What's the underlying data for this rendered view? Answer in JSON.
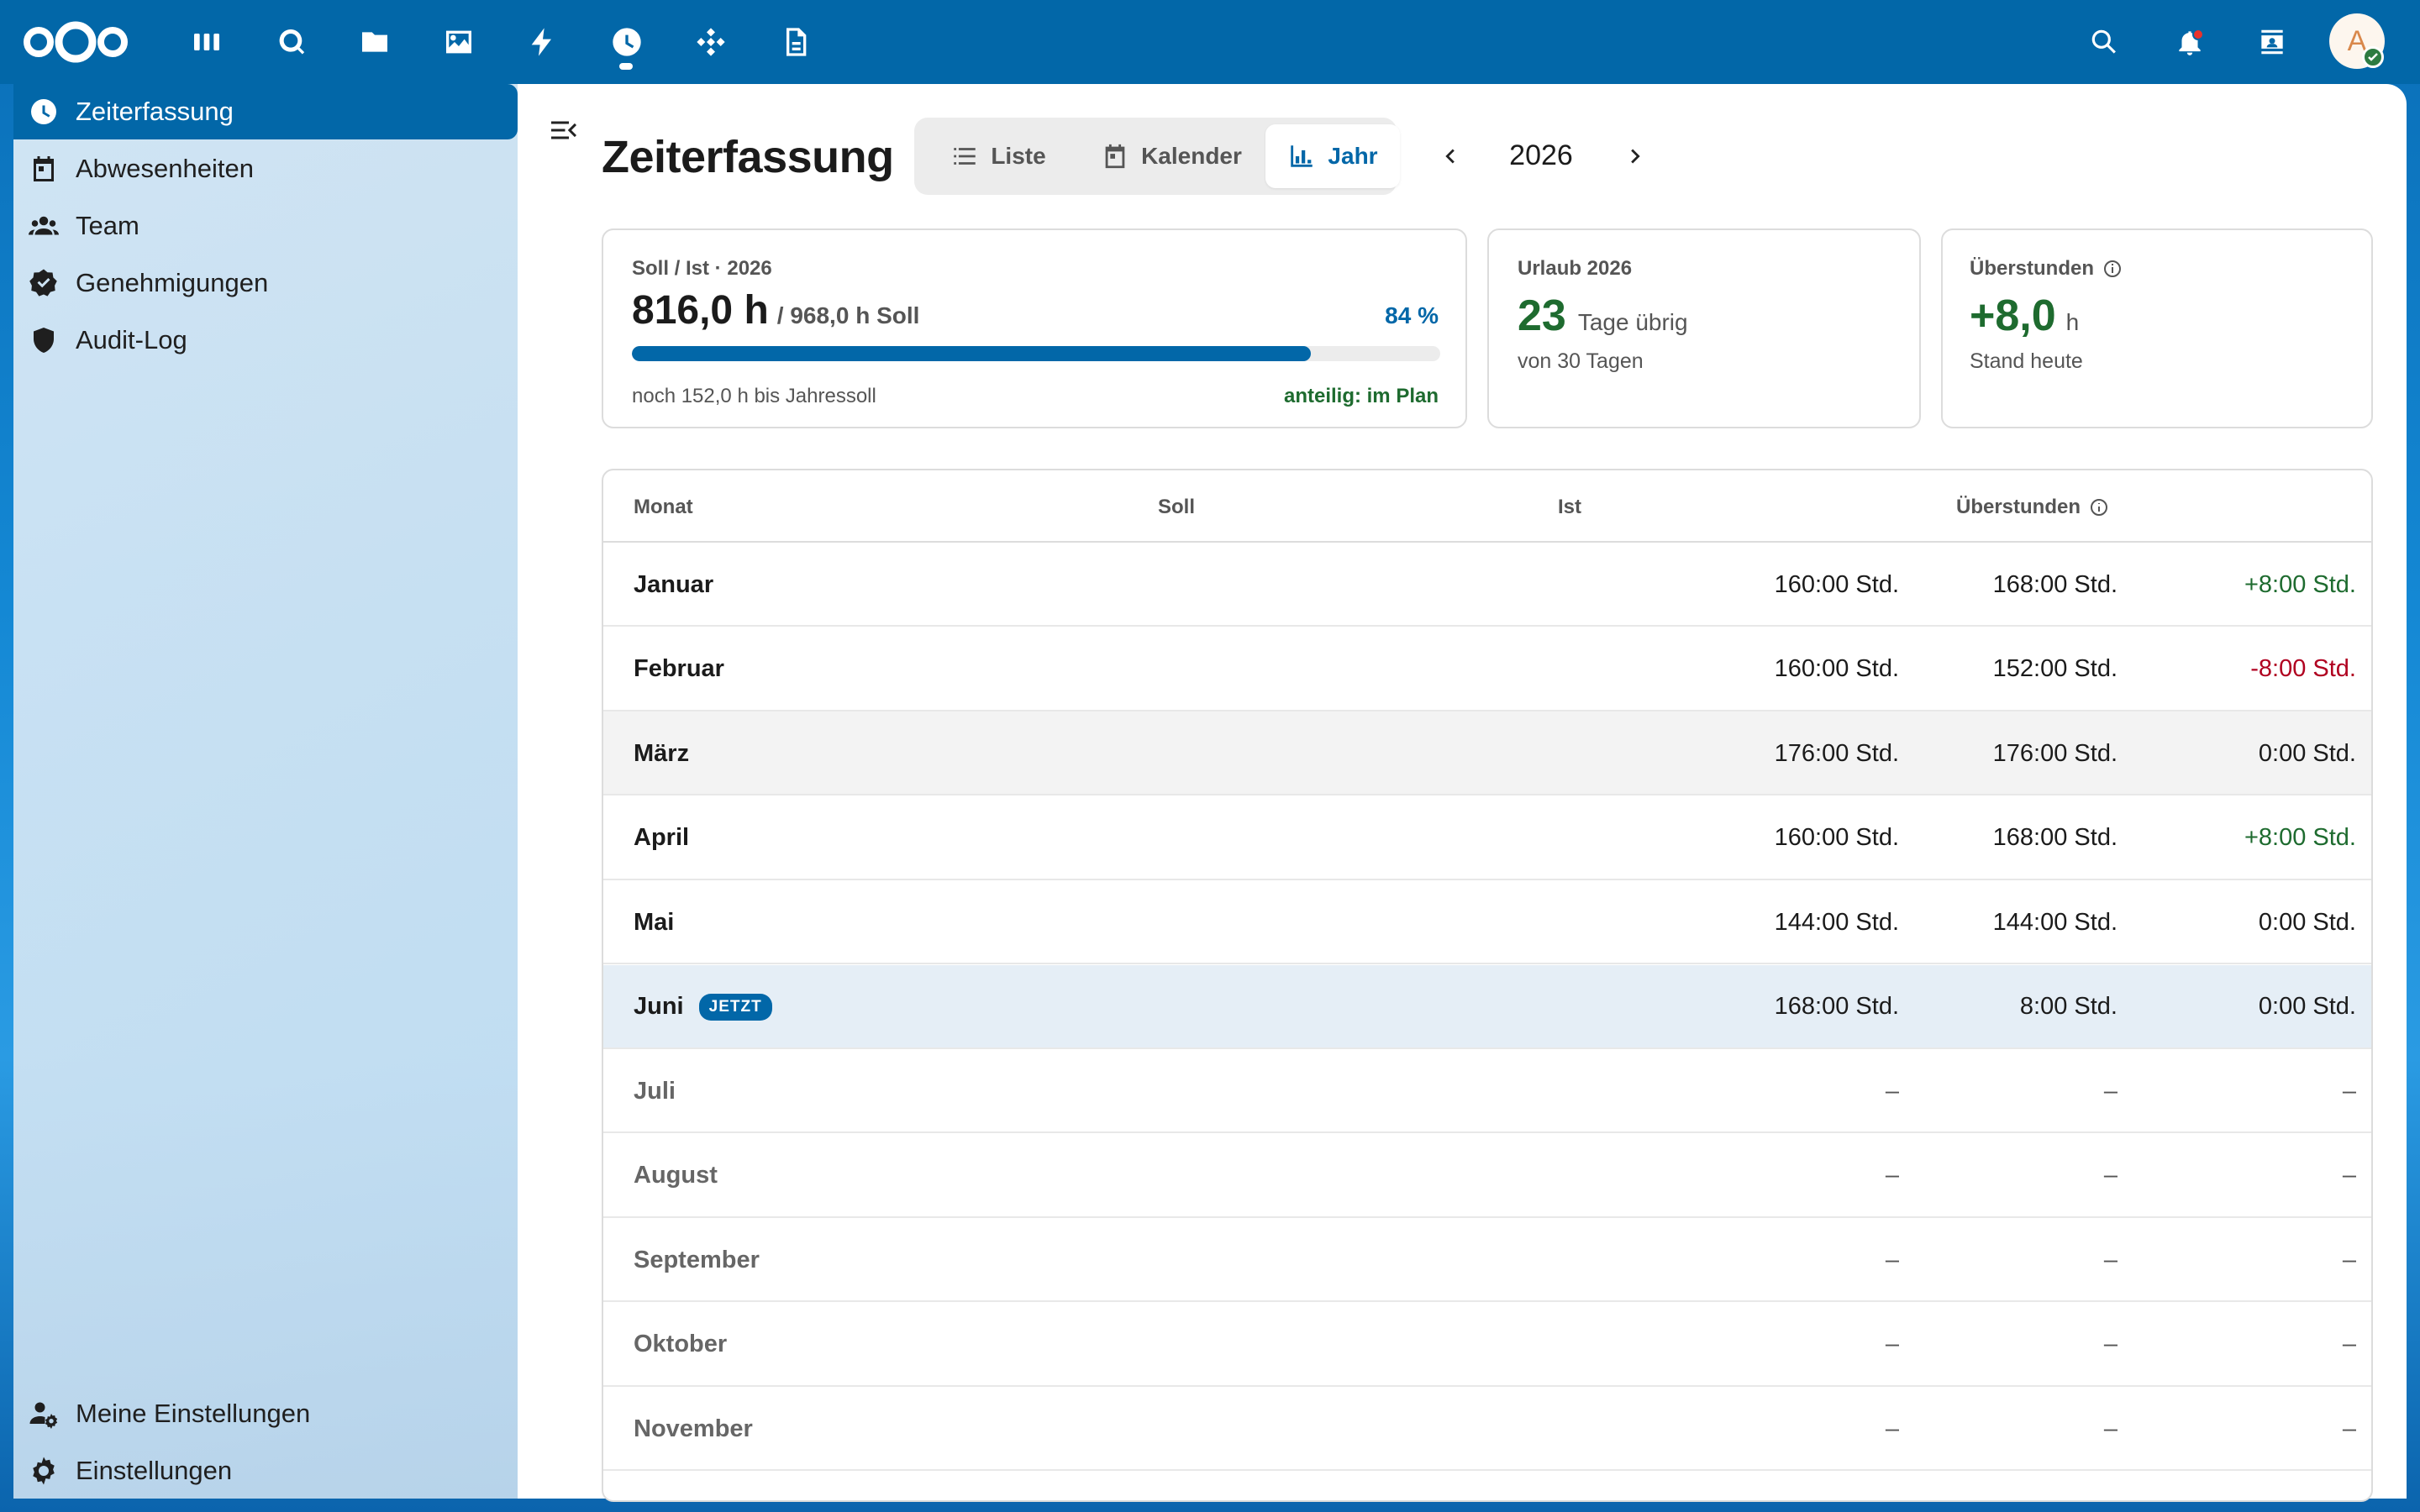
{
  "topbar": {
    "apps": [
      {
        "name": "dashboard-icon"
      },
      {
        "name": "search-app-icon"
      },
      {
        "name": "files-icon"
      },
      {
        "name": "photos-icon"
      },
      {
        "name": "activity-icon"
      },
      {
        "name": "timetracking-icon",
        "active": true
      },
      {
        "name": "integration-icon"
      },
      {
        "name": "text-icon"
      }
    ],
    "right": [
      "search-icon",
      "notifications-icon",
      "contacts-icon"
    ],
    "avatar_letter": "A"
  },
  "sidebar": {
    "items": [
      {
        "label": "Zeiterfassung",
        "icon": "clock-icon",
        "active": true
      },
      {
        "label": "Abwesenheiten",
        "icon": "calendar-icon"
      },
      {
        "label": "Team",
        "icon": "team-icon"
      },
      {
        "label": "Genehmigungen",
        "icon": "approval-icon"
      },
      {
        "label": "Audit-Log",
        "icon": "shield-icon"
      }
    ],
    "bottom": [
      {
        "label": "Meine Einstellungen",
        "icon": "user-settings-icon"
      },
      {
        "label": "Einstellungen",
        "icon": "gear-icon"
      }
    ]
  },
  "main": {
    "title": "Zeiterfassung",
    "views": [
      {
        "label": "Liste",
        "icon": "list-icon"
      },
      {
        "label": "Kalender",
        "icon": "calendar-icon"
      },
      {
        "label": "Jahr",
        "icon": "bar-chart-icon",
        "active": true
      }
    ],
    "year": "2026"
  },
  "cards": {
    "target": {
      "label": "Soll / Ist · 2026",
      "value": "816,0 h",
      "target_text": "/ 968,0 h Soll",
      "percent": "84 %",
      "progress_fraction": 0.84,
      "remaining": "noch 152,0 h bis Jahressoll",
      "status": "anteilig: im Plan"
    },
    "vacation": {
      "label": "Urlaub 2026",
      "value": "23",
      "unit": "Tage übrig",
      "sub": "von 30 Tagen"
    },
    "overtime": {
      "label": "Überstunden",
      "value": "+8,0",
      "unit": "h",
      "sub": "Stand heute"
    }
  },
  "table": {
    "headers": {
      "month": "Monat",
      "soll": "Soll",
      "ist": "Ist",
      "overtime": "Überstunden"
    },
    "current_badge": "JETZT",
    "rows": [
      {
        "month": "Januar",
        "soll": "160:00 Std.",
        "ist": "168:00 Std.",
        "overtime": "+8:00 Std.",
        "sign": "pos"
      },
      {
        "month": "Februar",
        "soll": "160:00 Std.",
        "ist": "152:00 Std.",
        "overtime": "-8:00 Std.",
        "sign": "neg"
      },
      {
        "month": "März",
        "soll": "176:00 Std.",
        "ist": "176:00 Std.",
        "overtime": "0:00 Std.",
        "sign": "zero"
      },
      {
        "month": "April",
        "soll": "160:00 Std.",
        "ist": "168:00 Std.",
        "overtime": "+8:00 Std.",
        "sign": "pos"
      },
      {
        "month": "Mai",
        "soll": "144:00 Std.",
        "ist": "144:00 Std.",
        "overtime": "0:00 Std.",
        "sign": "zero"
      },
      {
        "month": "Juni",
        "soll": "168:00 Std.",
        "ist": "8:00 Std.",
        "overtime": "0:00 Std.",
        "sign": "zero"
      },
      {
        "month": "Juli",
        "soll": "–",
        "ist": "–",
        "overtime": "–",
        "sign": "none"
      },
      {
        "month": "August",
        "soll": "–",
        "ist": "–",
        "overtime": "–",
        "sign": "none"
      },
      {
        "month": "September",
        "soll": "–",
        "ist": "–",
        "overtime": "–",
        "sign": "none"
      },
      {
        "month": "Oktober",
        "soll": "–",
        "ist": "–",
        "overtime": "–",
        "sign": "none"
      },
      {
        "month": "November",
        "soll": "–",
        "ist": "–",
        "overtime": "–",
        "sign": "none"
      }
    ]
  },
  "colors": {
    "accent": "#0267a8",
    "positive": "#1e6b2f",
    "negative": "#b00020"
  }
}
